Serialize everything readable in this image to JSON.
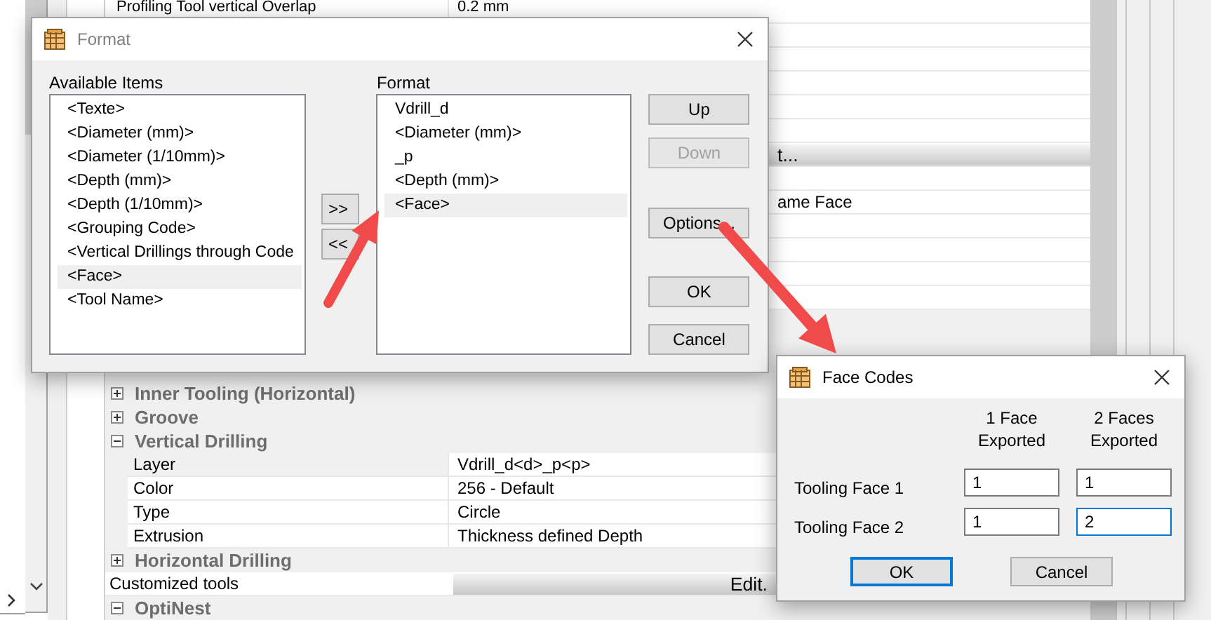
{
  "property_grid": {
    "top_row": {
      "name": "Profiling Tool vertical Overlap",
      "value": "0.2 mm"
    },
    "partial_button": "t...",
    "partial_value": "ame Face",
    "rows": [
      {
        "kind": "section",
        "title": "Inner Tooling (Horizontal)",
        "expanded": false
      },
      {
        "kind": "section",
        "title": "Groove",
        "expanded": false
      },
      {
        "kind": "section",
        "title": "Vertical Drilling",
        "expanded": true,
        "children": [
          {
            "name": "Layer",
            "value": "Vdrill_d<d>_p<p>",
            "selected": true
          },
          {
            "name": "Color",
            "value": "256 - Default",
            "selected": false
          },
          {
            "name": "Type",
            "value": "Circle",
            "selected": false
          },
          {
            "name": "Extrusion",
            "value": "Thickness defined Depth",
            "selected": false
          }
        ]
      },
      {
        "kind": "section",
        "title": "Horizontal Drilling",
        "expanded": false
      },
      {
        "kind": "button",
        "name": "Customized tools",
        "button": "Edit."
      },
      {
        "kind": "section",
        "title": "OptiNest",
        "expanded": true
      }
    ]
  },
  "format_dialog": {
    "title": "Format",
    "available_label": "Available Items",
    "available_items": [
      {
        "text": "<Texte>",
        "selected": false
      },
      {
        "text": "<Diameter (mm)>",
        "selected": false
      },
      {
        "text": "<Diameter (1/10mm)>",
        "selected": false
      },
      {
        "text": "<Depth (mm)>",
        "selected": false
      },
      {
        "text": "<Depth (1/10mm)>",
        "selected": false
      },
      {
        "text": "<Grouping Code>",
        "selected": false
      },
      {
        "text": "<Vertical Drillings through Code",
        "selected": false
      },
      {
        "text": "<Face>",
        "selected": true
      },
      {
        "text": "<Tool Name>",
        "selected": false
      }
    ],
    "add_button": ">>",
    "remove_button": "<<",
    "format_label": "Format",
    "format_items": [
      {
        "text": "Vdrill_d",
        "selected": false
      },
      {
        "text": "<Diameter (mm)>",
        "selected": false
      },
      {
        "text": "_p",
        "selected": false
      },
      {
        "text": "<Depth (mm)>",
        "selected": false
      },
      {
        "text": "<Face>",
        "selected": true
      }
    ],
    "buttons": [
      {
        "label": "Up",
        "disabled": false
      },
      {
        "label": "Down",
        "disabled": true
      },
      {
        "label": "Options...",
        "disabled": false
      },
      {
        "label": "OK",
        "disabled": false
      },
      {
        "label": "Cancel",
        "disabled": false
      }
    ]
  },
  "face_codes_dialog": {
    "title": "Face Codes",
    "columns": [
      "1 Face Exported",
      "2 Faces Exported"
    ],
    "rows": [
      {
        "label": "Tooling Face 1",
        "values": [
          {
            "value": "1",
            "focused": false
          },
          {
            "value": "1",
            "focused": false
          }
        ]
      },
      {
        "label": "Tooling Face 2",
        "values": [
          {
            "value": "1",
            "focused": false
          },
          {
            "value": "2",
            "focused": true
          }
        ]
      }
    ],
    "buttons": [
      {
        "label": "OK",
        "default": true
      },
      {
        "label": "Cancel",
        "default": false
      }
    ]
  }
}
